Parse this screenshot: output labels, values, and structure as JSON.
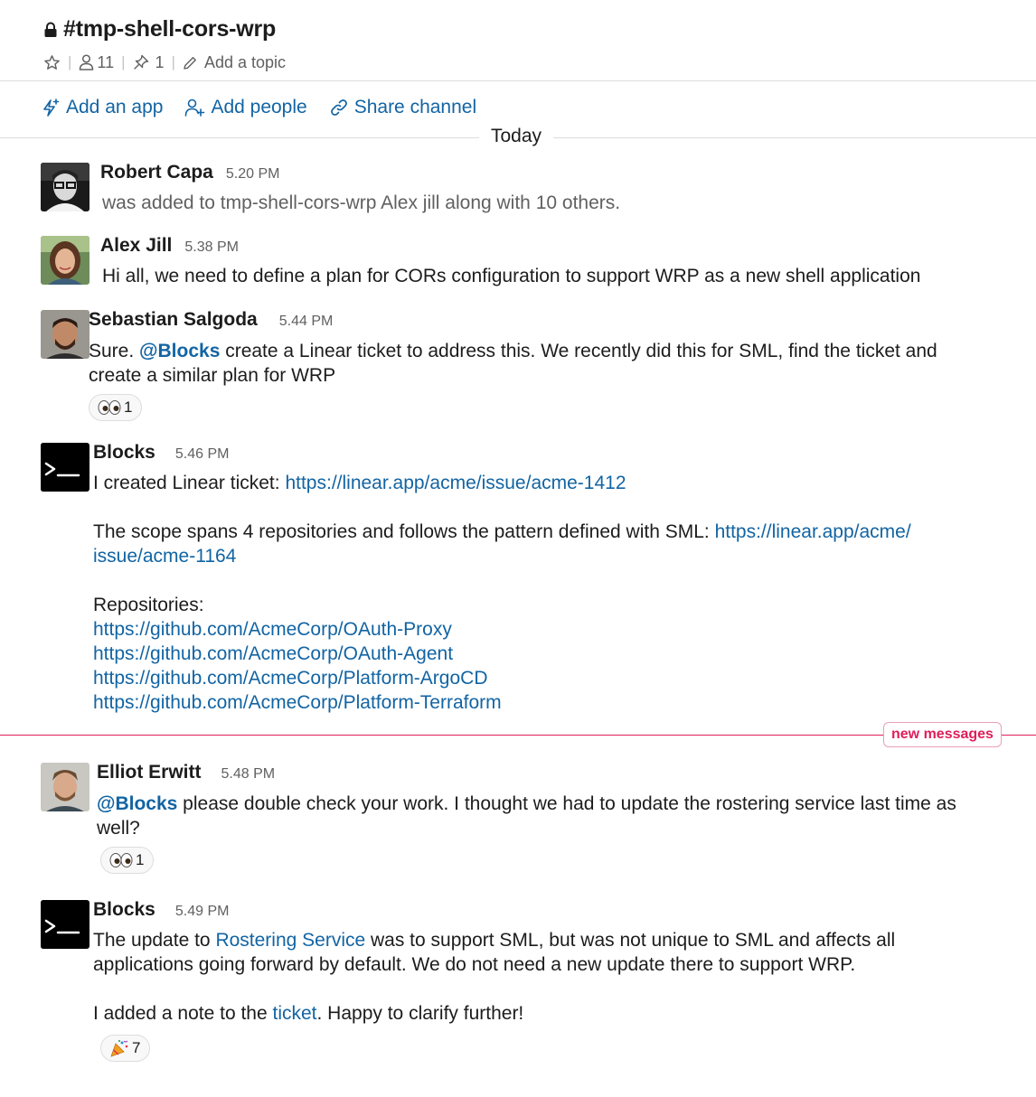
{
  "channel": {
    "name": "#tmp-shell-cors-wrp",
    "members_count": "11",
    "pins_count": "1",
    "topic_placeholder": "Add a topic"
  },
  "actions": {
    "add_app": "Add an app",
    "add_people": "Add people",
    "share_channel": "Share channel"
  },
  "day_divider": "Today",
  "new_messages_label": "new messages",
  "colors": {
    "link": "#1264a3",
    "new_messages": "#e01e5a",
    "muted": "#616061"
  },
  "messages": [
    {
      "author": "Robert Capa",
      "time": "5.20 PM",
      "text": "was added to tmp-shell-cors-wrp Alex jill along with 10 others."
    },
    {
      "author": "Alex Jill",
      "time": "5.38 PM",
      "text": "Hi all, we need to define a plan for CORs configuration to support WRP as a new shell application"
    },
    {
      "author": "Sebastian Salgoda",
      "time": "5.44 PM",
      "text_before": "Sure. ",
      "mention": "@Blocks",
      "text_after": " create a Linear ticket to address this. We recently did this for SML, find the ticket and create a similar plan for WRP",
      "reaction": {
        "emoji": "eyes-emoji",
        "count": "1"
      }
    },
    {
      "author": "Blocks",
      "time": "5.46 PM",
      "line1_text": "I created Linear ticket: ",
      "line1_link": "https://linear.app/acme/issue/acme-1412",
      "line2_text": "The scope spans 4 repositories and follows the pattern defined with SML: ",
      "line2_link_a": "https://linear.app/acme/",
      "line2_link_b": "issue/acme-1164",
      "repos_label": "Repositories:",
      "repos": [
        "https://github.com/AcmeCorp/OAuth-Proxy",
        "https://github.com/AcmeCorp/OAuth-Agent",
        "https://github.com/AcmeCorp/Platform-ArgoCD",
        "https://github.com/AcmeCorp/Platform-Terraform"
      ]
    },
    {
      "author": "Elliot Erwitt",
      "time": "5.48 PM",
      "mention": "@Blocks",
      "text_after": " please double check your work. I thought we had to update the rostering service last time as well?",
      "reaction": {
        "emoji": "eyes-emoji",
        "count": "1"
      }
    },
    {
      "author": "Blocks",
      "time": "5.49 PM",
      "p1_before": "The update to ",
      "p1_link": "Rostering Service",
      "p1_after": " was to support SML, but was not unique to SML and affects all applications going forward by default. We do not need a new update there to support WRP.",
      "p2_before": "I added a note to the ",
      "p2_link": "ticket",
      "p2_after": ". Happy to clarify further!",
      "reaction": {
        "emoji": "party-popper-emoji",
        "count": "7"
      }
    }
  ]
}
